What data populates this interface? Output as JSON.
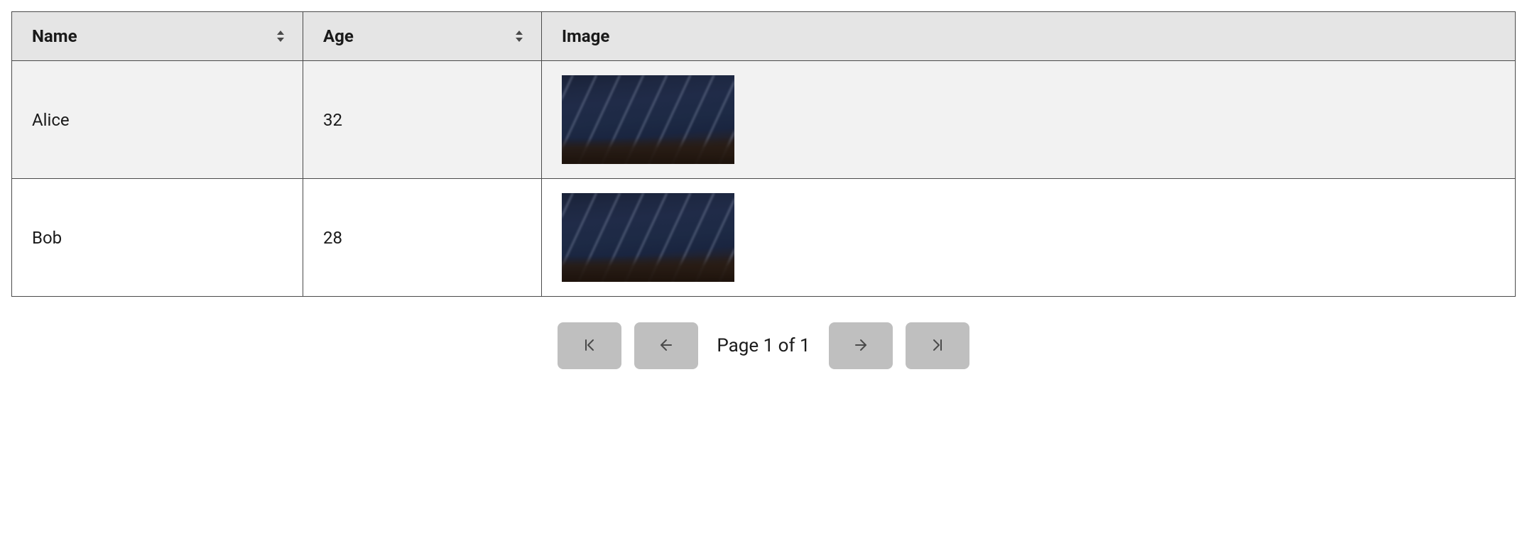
{
  "table": {
    "columns": [
      {
        "key": "name",
        "label": "Name",
        "sortable": true
      },
      {
        "key": "age",
        "label": "Age",
        "sortable": true
      },
      {
        "key": "image",
        "label": "Image",
        "sortable": false
      }
    ],
    "rows": [
      {
        "name": "Alice",
        "age": "32",
        "image": "star-trails-night-sky"
      },
      {
        "name": "Bob",
        "age": "28",
        "image": "star-trails-night-sky"
      }
    ]
  },
  "pagination": {
    "label": "Page 1 of 1",
    "current": 1,
    "total": 1
  }
}
